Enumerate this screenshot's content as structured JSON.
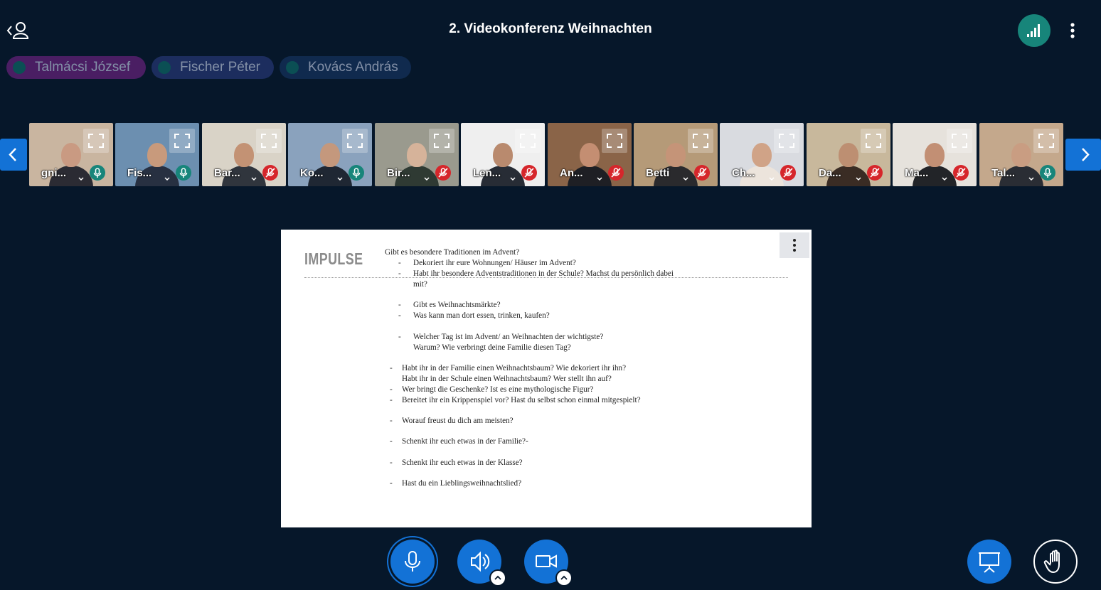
{
  "meeting": {
    "title": "2. Videokonferenz Weihnachten"
  },
  "talkers": [
    {
      "name": "Talmácsi József",
      "color": "#4a1e63"
    },
    {
      "name": "Fischer Péter",
      "color": "#1c2d5e"
    },
    {
      "name": "Kovács András",
      "color": "#102a4e"
    }
  ],
  "tiles": [
    {
      "name": "gni...",
      "muted": false,
      "bg": "#c9b5a0",
      "skin": "#c99a82",
      "cloth": "#2b2b33"
    },
    {
      "name": "Fis...",
      "muted": false,
      "bg": "#6c8fb0",
      "skin": "#c89a7c",
      "cloth": "#273041"
    },
    {
      "name": "Bar...",
      "muted": true,
      "bg": "#d9d3c7",
      "skin": "#c39274",
      "cloth": "#30353d"
    },
    {
      "name": "Ko...",
      "muted": false,
      "bg": "#8aa2bd",
      "skin": "#c4987d",
      "cloth": "#1f2733"
    },
    {
      "name": "Bir...",
      "muted": true,
      "bg": "#9a9a8e",
      "skin": "#d6b39a",
      "cloth": "#2f3a33"
    },
    {
      "name": "Len...",
      "muted": true,
      "bg": "#efefef",
      "skin": "#b98a6e",
      "cloth": "#272c35"
    },
    {
      "name": "An...",
      "muted": true,
      "bg": "#8a6448",
      "skin": "#c48e72",
      "cloth": "#1e1f24"
    },
    {
      "name": "Betti",
      "muted": true,
      "bg": "#b59a78",
      "skin": "#c59478",
      "cloth": "#2a2a2d"
    },
    {
      "name": "Ch...",
      "muted": true,
      "bg": "#d9dbe0",
      "skin": "#d0a387",
      "cloth": "#ece4dc"
    },
    {
      "name": "Da...",
      "muted": true,
      "bg": "#c8b89c",
      "skin": "#bd8f72",
      "cloth": "#3a2c24"
    },
    {
      "name": "Ma...",
      "muted": true,
      "bg": "#e6e2dc",
      "skin": "#c28f74",
      "cloth": "#222428"
    },
    {
      "name": "Tal...",
      "muted": false,
      "bg": "#c4a88c",
      "skin": "#c99d82",
      "cloth": "#2a2d34"
    }
  ],
  "slide": {
    "heading": "IMPULSE",
    "lines": [
      {
        "bullet": "",
        "text": "Gibt es besondere Traditionen im Advent?"
      },
      {
        "bullet": "-",
        "text": "Dekoriert ihr eure Wohnungen/ Häuser im Advent?"
      },
      {
        "bullet": "-",
        "text": "Habt ihr besondere Adventstraditionen in der Schule? Machst du persönlich dabei"
      },
      {
        "bullet": "",
        "text": "mit?"
      },
      {
        "bullet": "-",
        "text": "Gibt es  Weihnachtsmärkte?"
      },
      {
        "bullet": "-",
        "text": "Was kann man dort essen, trinken, kaufen?"
      },
      {
        "bullet": "-",
        "text": "Welcher Tag ist im Advent/ an Weihnachten der wichtigste?"
      },
      {
        "bullet": "",
        "text": "Warum? Wie verbringt deine Familie diesen Tag?"
      },
      {
        "bullet": "-",
        "text": "Habt ihr in der Familie einen Weihnachtsbaum? Wie dekoriert ihr ihn?"
      },
      {
        "bullet": "",
        "text": "Habt ihr in der Schule einen Weihnachtsbaum? Wer stellt ihn auf?"
      },
      {
        "bullet": "-",
        "text": "Wer bringt die Geschenke? Ist es eine mythologische Figur?"
      },
      {
        "bullet": "-",
        "text": "Bereitet ihr ein Krippenspiel vor? Hast du selbst schon einmal mitgespielt?"
      },
      {
        "bullet": "-",
        "text": "Worauf freust du dich am meisten?"
      },
      {
        "bullet": "-",
        "text": "Schenkt ihr euch etwas in der Familie?-"
      },
      {
        "bullet": "-",
        "text": "Schenkt ihr euch etwas in der Klasse?"
      },
      {
        "bullet": "-",
        "text": "Hast du ein Lieblingsweihnachtslied?"
      }
    ]
  },
  "colors": {
    "primary": "#1372d6",
    "background": "#06172a",
    "talking": "#17857a",
    "muted": "#d6262b"
  }
}
